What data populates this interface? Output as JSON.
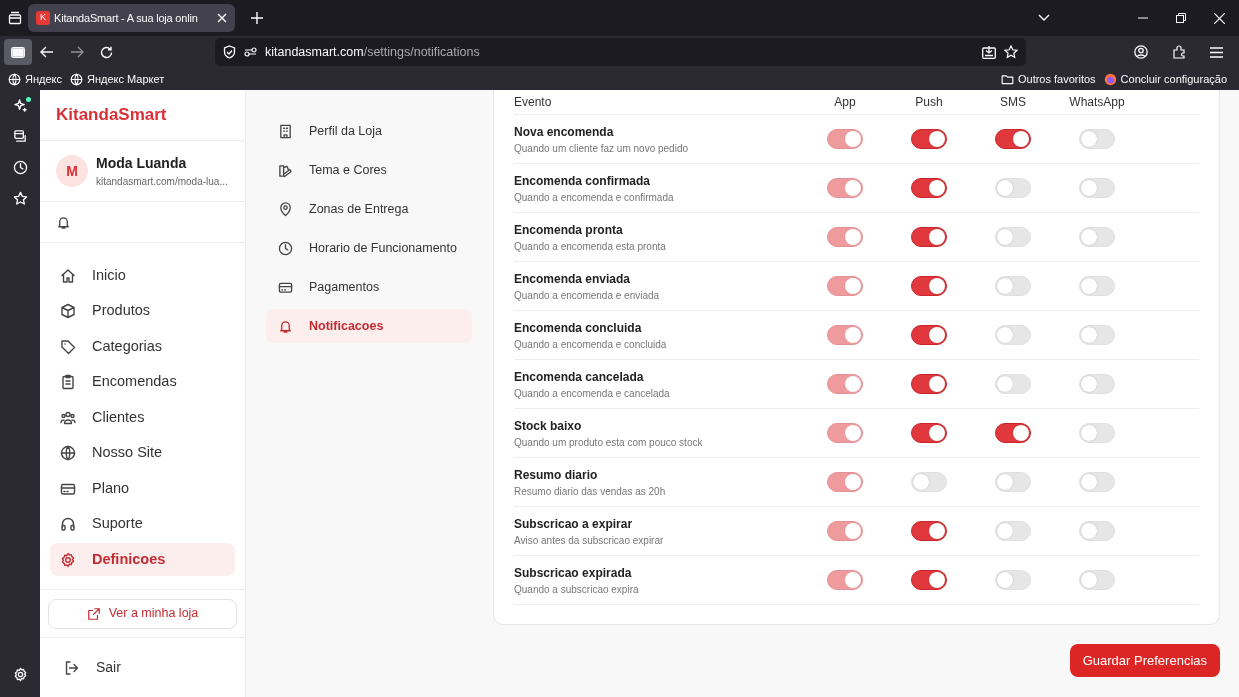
{
  "browser": {
    "favicon_letter": "K",
    "tab_title": "KitandaSmart - A sua loja onlin",
    "url_host": "kitandasmart.com",
    "url_path": "/settings/notifications",
    "bookmarks_left": [
      "Яндекс",
      "Яндекс Маркет"
    ],
    "bookmarks_right": [
      "Outros favoritos",
      "Concluir configuração"
    ]
  },
  "sidebar": {
    "brand": "KitandaSmart",
    "store": {
      "initial": "M",
      "name": "Moda Luanda",
      "url": "kitandasmart.com/moda-lua..."
    },
    "nav": [
      {
        "label": "Inicio",
        "selected": false
      },
      {
        "label": "Produtos",
        "selected": false
      },
      {
        "label": "Categorias",
        "selected": false
      },
      {
        "label": "Encomendas",
        "selected": false
      },
      {
        "label": "Clientes",
        "selected": false
      },
      {
        "label": "Nosso Site",
        "selected": false
      },
      {
        "label": "Plano",
        "selected": false
      },
      {
        "label": "Suporte",
        "selected": false
      },
      {
        "label": "Definicoes",
        "selected": true
      }
    ],
    "view_store_button": "Ver a minha loja",
    "logout": "Sair"
  },
  "settings_nav": [
    {
      "label": "Perfil da Loja",
      "selected": false
    },
    {
      "label": "Tema e Cores",
      "selected": false
    },
    {
      "label": "Zonas de Entrega",
      "selected": false
    },
    {
      "label": "Horario de Funcionamento",
      "selected": false
    },
    {
      "label": "Pagamentos",
      "selected": false
    },
    {
      "label": "Notificacoes",
      "selected": true
    }
  ],
  "table": {
    "columns": [
      "Evento",
      "App",
      "Push",
      "SMS",
      "WhatsApp"
    ],
    "rows": [
      {
        "title": "Nova encomenda",
        "description": "Quando um cliente faz um novo pedido",
        "toggles": [
          {
            "checked": true,
            "disabled": true
          },
          {
            "checked": true,
            "disabled": false
          },
          {
            "checked": true,
            "disabled": false
          },
          {
            "checked": false,
            "disabled": false
          }
        ]
      },
      {
        "title": "Encomenda confirmada",
        "description": "Quando a encomenda e confirmada",
        "toggles": [
          {
            "checked": true,
            "disabled": true
          },
          {
            "checked": true,
            "disabled": false
          },
          {
            "checked": false,
            "disabled": false
          },
          {
            "checked": false,
            "disabled": false
          }
        ]
      },
      {
        "title": "Encomenda pronta",
        "description": "Quando a encomenda esta pronta",
        "toggles": [
          {
            "checked": true,
            "disabled": true
          },
          {
            "checked": true,
            "disabled": false
          },
          {
            "checked": false,
            "disabled": false
          },
          {
            "checked": false,
            "disabled": false
          }
        ]
      },
      {
        "title": "Encomenda enviada",
        "description": "Quando a encomenda e enviada",
        "toggles": [
          {
            "checked": true,
            "disabled": true
          },
          {
            "checked": true,
            "disabled": false
          },
          {
            "checked": false,
            "disabled": false
          },
          {
            "checked": false,
            "disabled": false
          }
        ]
      },
      {
        "title": "Encomenda concluida",
        "description": "Quando a encomenda e concluida",
        "toggles": [
          {
            "checked": true,
            "disabled": true
          },
          {
            "checked": true,
            "disabled": false
          },
          {
            "checked": false,
            "disabled": false
          },
          {
            "checked": false,
            "disabled": false
          }
        ]
      },
      {
        "title": "Encomenda cancelada",
        "description": "Quando a encomenda e cancelada",
        "toggles": [
          {
            "checked": true,
            "disabled": true
          },
          {
            "checked": true,
            "disabled": false
          },
          {
            "checked": false,
            "disabled": false
          },
          {
            "checked": false,
            "disabled": false
          }
        ]
      },
      {
        "title": "Stock baixo",
        "description": "Quando um produto esta com pouco stock",
        "toggles": [
          {
            "checked": true,
            "disabled": true
          },
          {
            "checked": true,
            "disabled": false
          },
          {
            "checked": true,
            "disabled": false
          },
          {
            "checked": false,
            "disabled": false
          }
        ]
      },
      {
        "title": "Resumo diario",
        "description": "Resumo diario das vendas as 20h",
        "toggles": [
          {
            "checked": true,
            "disabled": true
          },
          {
            "checked": false,
            "disabled": false
          },
          {
            "checked": false,
            "disabled": false
          },
          {
            "checked": false,
            "disabled": false
          }
        ]
      },
      {
        "title": "Subscricao a expirar",
        "description": "Aviso antes da subscricao expirar",
        "toggles": [
          {
            "checked": true,
            "disabled": true
          },
          {
            "checked": true,
            "disabled": false
          },
          {
            "checked": false,
            "disabled": false
          },
          {
            "checked": false,
            "disabled": false
          }
        ]
      },
      {
        "title": "Subscricao expirada",
        "description": "Quando a subscricao expira",
        "toggles": [
          {
            "checked": true,
            "disabled": true
          },
          {
            "checked": true,
            "disabled": false
          },
          {
            "checked": false,
            "disabled": false
          },
          {
            "checked": false,
            "disabled": false
          }
        ]
      }
    ]
  },
  "save_button": "Guardar Preferencias"
}
